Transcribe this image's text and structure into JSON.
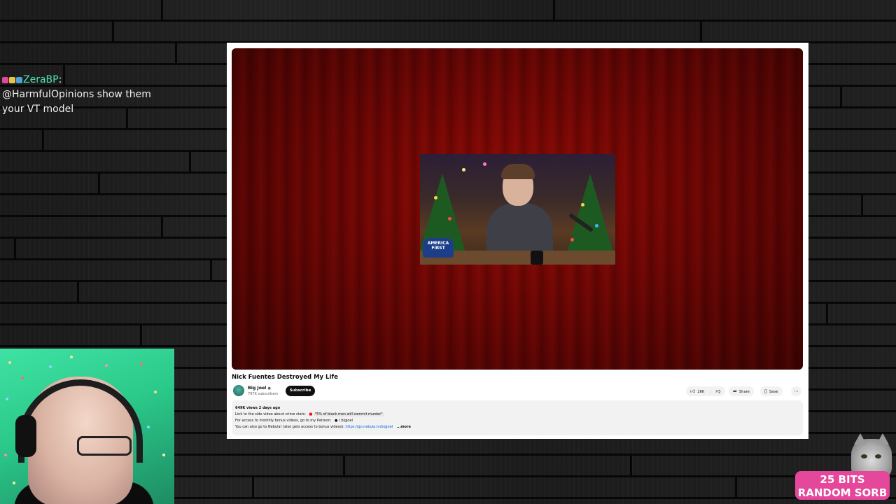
{
  "chat": {
    "username": "ZeraBP",
    "separator": ":",
    "message": "@HarmfulOpinions show them your VT model"
  },
  "youtube": {
    "video_title": "Nick Fuentes Destroyed My Life",
    "inner_video": {
      "hat_text": "AMERICA FIRST"
    },
    "channel": {
      "name": "Big Joel",
      "verified_icon": "verified-check-icon",
      "subscribers": "797K subscribers"
    },
    "subscribe_label": "Subscribe",
    "actions": {
      "like_count": "26K",
      "share_label": "Share",
      "save_label": "Save",
      "more_icon": "more-horizontal-icon"
    },
    "description": {
      "meta": "649K views  2 days ago",
      "line1_text": "Link to the side video about crime stats:",
      "line1_quote": "\"5% of black men will commit murder\"",
      "line2_text": "For access to monthly bonus videos, go to my Patreon:",
      "line2_link": "/ bigjoel",
      "line3_text": "You can also go to Nebula! (also gets access to bonus videos):",
      "line3_link": "https://go.nebula.tv/bigjoel",
      "more_label": "...more"
    }
  },
  "alert": {
    "line1": "25 BITS",
    "line2": "RANDOM SORB"
  },
  "colors": {
    "chat_username": "#4fe3b0",
    "alert_bg": "#e5479a",
    "curtain_red": "#6a0604",
    "subscribe_bg": "#0f0f0f",
    "link_blue": "#065fd4"
  }
}
